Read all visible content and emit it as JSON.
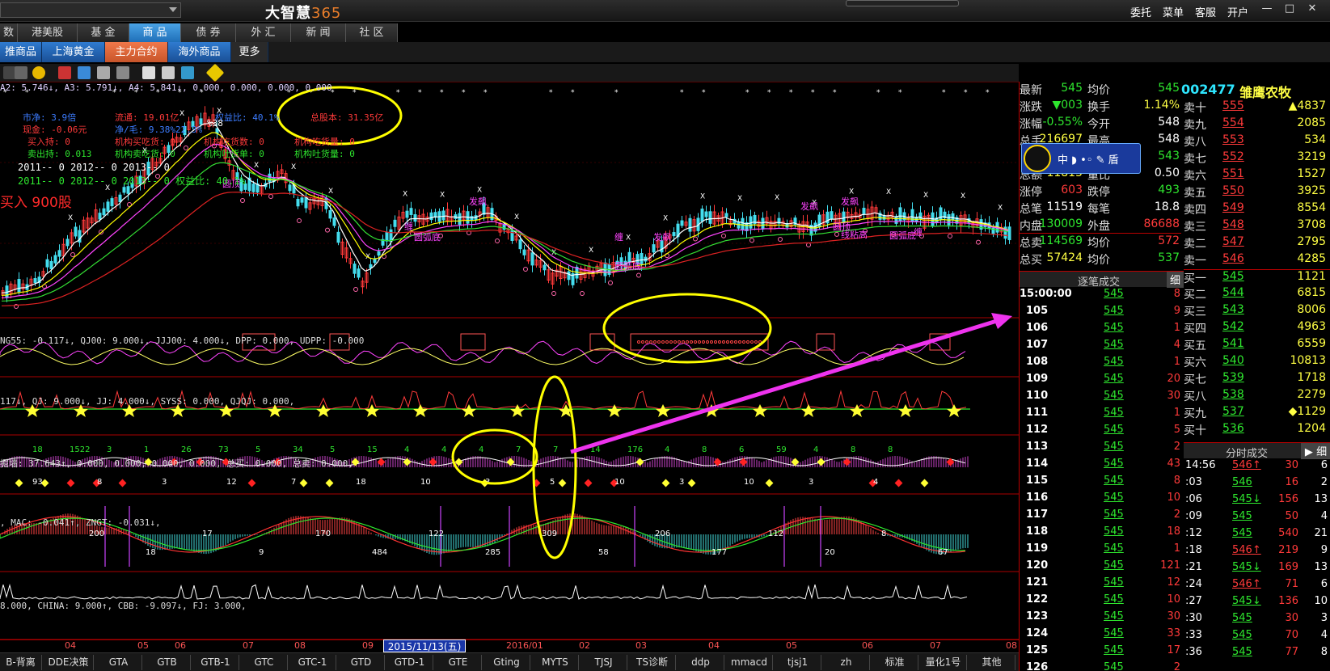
{
  "titlebar": {
    "brand": "大智慧",
    "brand_num": "365",
    "menus": [
      "委托",
      "菜单",
      "客服",
      "开户"
    ],
    "win_buttons": [
      "—",
      "□",
      "✕"
    ]
  },
  "tabs1": [
    "数",
    "港美股",
    "基 金",
    "商 品",
    "债 券",
    "外 汇",
    "新 闻",
    "社 区"
  ],
  "tabs1_active": 3,
  "tabs2": [
    "推商品",
    "上海黄金",
    "主力合约",
    "海外商品",
    "更多"
  ],
  "tabs2_active": 2,
  "chart": {
    "main_indicator": "A2: 5.746↓, A3: 5.791↓, A4: 5.841↓, 0.000, 0.000, 0.000, 0.000",
    "info": [
      {
        "t": "市净: 3.9倍",
        "c": "#3c7cff"
      },
      {
        "t": "流通: 19.01亿",
        "c": "#ff3a3a"
      },
      {
        "t": "权益比: 40.1%",
        "c": "#3c7cff"
      },
      {
        "t": "总股本: 31.35亿",
        "c": "#ff3a3a"
      },
      {
        "t": "现金: -0.06元",
        "c": "#ff3a3a"
      },
      {
        "t": "净/毛: 9.38%22.3%",
        "c": "#3c7cff"
      },
      {
        "t": "买入持: 0",
        "c": "#ff3a3a"
      },
      {
        "t": "机构买吃货: 0",
        "c": "#ff3a3a"
      },
      {
        "t": "机构吃货数: 0",
        "c": "#ff3a3a"
      },
      {
        "t": "机构吃货量: 0",
        "c": "#ff3a3a"
      },
      {
        "t": "卖出持: 0.013",
        "c": "#2ee62e"
      },
      {
        "t": "机构卖吃货: 0",
        "c": "#2ee62e"
      },
      {
        "t": "机构吐货单: 0",
        "c": "#2ee62e"
      },
      {
        "t": "机构吐货量: 0",
        "c": "#2ee62e"
      }
    ],
    "year_row1": "2011-- 0    2012-- 0    2013-- 0",
    "year_row2": "2011-- 0    2012-- 0    2013-- 0   权益比: 40.1%",
    "buy_label": "买入 900股",
    "pct_label": "%38",
    "pane_indicators": [
      {
        "t": "NG55: -0.117↓, QJ00: 9.000↓, JJJ00: 4.000↓, DPP: 0.000, UDPP: -0.000"
      },
      {
        "t": "117↓, QJ: 9.000↓, JJ: 4.000↓, SYSS: 0.000, QJQJ: 0.000,"
      },
      {
        "t": "掘墙: 37.643↑, 0.000, 0.000, 0.000, 0.000, 总买: 0.000, 总卖: 0.000,"
      },
      {
        "t": ", MAC: -0.041↑, ZNGT: -0.031↓,"
      },
      {
        "t": "8.000, CHINA: 9.000↑, CBB: -9.097↓, FJ: 3.000,"
      }
    ],
    "date_marker": "2015/11/13(五)",
    "xaxis": [
      "04",
      "05",
      "06",
      "07",
      "08",
      "09",
      "2016/01",
      "02",
      "03",
      "04",
      "05",
      "06",
      "07",
      "08"
    ],
    "annotations": [
      "发飙",
      "发飙",
      "发飙",
      "发飙",
      "圆顶",
      "圆弧底",
      "圆弧底",
      "圆弧底",
      "缠",
      "缠",
      "缠",
      "圆顶",
      "线粘高"
    ],
    "pane4_numbers": [
      "18",
      "1522",
      "3",
      "1",
      "26",
      "73",
      "5",
      "34",
      "5",
      "15",
      "4",
      "4",
      "4",
      "7",
      "7",
      "14",
      "176",
      "4",
      "8",
      "6",
      "59",
      "4",
      "8",
      "8",
      "93",
      "8",
      "3",
      "12",
      "7",
      "18",
      "10",
      "3",
      "5",
      "10",
      "3",
      "10",
      "3",
      "4"
    ],
    "pane5_numbers": [
      "200",
      "18",
      "17",
      "9",
      "170",
      "484",
      "122",
      "285",
      "309",
      "58",
      "206",
      "177",
      "112",
      "20",
      "8",
      "67"
    ]
  },
  "quote": {
    "stock_code": "002477",
    "stock_name": "雏鹰农牧",
    "left": [
      {
        "l": "最新",
        "v": "545",
        "vc": "grn",
        "l2": "均价",
        "v2": "545",
        "v2c": "grn"
      },
      {
        "l": "涨跌",
        "v": "▼003",
        "vc": "grn",
        "l2": "换手",
        "v2": "1.14%",
        "v2c": "yel"
      },
      {
        "l": "涨幅",
        "v": "-0.55%",
        "vc": "grn",
        "l2": "今开",
        "v2": "548",
        "v2c": "wht"
      },
      {
        "l": "总手",
        "v": "216697",
        "vc": "yel",
        "l2": "最高",
        "v2": "548",
        "v2c": "wht"
      },
      {
        "l": "",
        "v": "",
        "vc": "wht",
        "l2": "",
        "v2": "543",
        "v2c": "grn"
      },
      {
        "l": "总额",
        "v": "11815",
        "vc": "yel",
        "l2": "量比",
        "v2": "0.50",
        "v2c": "wht"
      },
      {
        "l": "涨停",
        "v": "603",
        "vc": "red",
        "l2": "跌停",
        "v2": "493",
        "v2c": "grn"
      },
      {
        "l": "总笔",
        "v": "11519",
        "vc": "wht",
        "l2": "每笔",
        "v2": "18.8",
        "v2c": "wht"
      },
      {
        "l": "内盘",
        "v": "130009",
        "vc": "grn",
        "l2": "外盘",
        "v2": "86688",
        "v2c": "red"
      },
      {
        "l": "总卖",
        "v": "114569",
        "vc": "grn",
        "l2": "均价",
        "v2": "572",
        "v2c": "red"
      },
      {
        "l": "总买",
        "v": "57424",
        "vc": "yel",
        "l2": "均价",
        "v2": "537",
        "v2c": "grn"
      }
    ],
    "qq_bar": "中 ◗ •◦ ✎ 盾",
    "sell": [
      {
        "l": "卖十",
        "p": "555",
        "v": "▲4837"
      },
      {
        "l": "卖九",
        "p": "554",
        "v": "2085"
      },
      {
        "l": "卖八",
        "p": "553",
        "v": "534"
      },
      {
        "l": "卖七",
        "p": "552",
        "v": "3219"
      },
      {
        "l": "卖六",
        "p": "551",
        "v": "1527"
      },
      {
        "l": "卖五",
        "p": "550",
        "v": "3925"
      },
      {
        "l": "卖四",
        "p": "549",
        "v": "8554"
      },
      {
        "l": "卖三",
        "p": "548",
        "v": "3708"
      },
      {
        "l": "卖二",
        "p": "547",
        "v": "2795"
      },
      {
        "l": "卖一",
        "p": "546",
        "v": "4285"
      }
    ],
    "buy": [
      {
        "l": "买一",
        "p": "545",
        "v": "1121"
      },
      {
        "l": "买二",
        "p": "544",
        "v": "6815"
      },
      {
        "l": "买三",
        "p": "543",
        "v": "8006"
      },
      {
        "l": "买四",
        "p": "542",
        "v": "4963"
      },
      {
        "l": "买五",
        "p": "541",
        "v": "6559"
      },
      {
        "l": "买六",
        "p": "540",
        "v": "10813"
      },
      {
        "l": "买七",
        "p": "539",
        "v": "1718"
      },
      {
        "l": "买八",
        "p": "538",
        "v": "2279"
      },
      {
        "l": "买九",
        "p": "537",
        "v": "◆1129"
      },
      {
        "l": "买十",
        "p": "536",
        "v": "1204"
      }
    ],
    "tick_header": "逐笔成交",
    "tick_tab": "细",
    "ticks": [
      {
        "t": "15:00:00",
        "p": "545",
        "v": "8"
      },
      {
        "t": "105",
        "p": "545",
        "v": "9"
      },
      {
        "t": "106",
        "p": "545",
        "v": "1"
      },
      {
        "t": "107",
        "p": "545",
        "v": "4"
      },
      {
        "t": "108",
        "p": "545",
        "v": "1"
      },
      {
        "t": "109",
        "p": "545",
        "v": "20"
      },
      {
        "t": "110",
        "p": "545",
        "v": "30"
      },
      {
        "t": "111",
        "p": "545",
        "v": "1"
      },
      {
        "t": "112",
        "p": "545",
        "v": "5"
      },
      {
        "t": "113",
        "p": "545",
        "v": "2"
      },
      {
        "t": "114",
        "p": "545",
        "v": "43"
      },
      {
        "t": "115",
        "p": "545",
        "v": "8"
      },
      {
        "t": "116",
        "p": "545",
        "v": "10"
      },
      {
        "t": "117",
        "p": "545",
        "v": "2"
      },
      {
        "t": "118",
        "p": "545",
        "v": "18"
      },
      {
        "t": "119",
        "p": "545",
        "v": "1"
      },
      {
        "t": "120",
        "p": "545",
        "v": "121"
      },
      {
        "t": "121",
        "p": "545",
        "v": "12"
      },
      {
        "t": "122",
        "p": "545",
        "v": "10"
      },
      {
        "t": "123",
        "p": "545",
        "v": "30"
      },
      {
        "t": "124",
        "p": "545",
        "v": "33"
      },
      {
        "t": "125",
        "p": "545",
        "v": "17"
      },
      {
        "t": "126",
        "p": "545",
        "v": "2"
      }
    ],
    "min_header": "分时成交",
    "min_tab": "细",
    "mins": [
      {
        "t": "14:56",
        "p": "546↑",
        "pc": "red",
        "v": "30",
        "n": "6"
      },
      {
        "t": ":03",
        "p": "546",
        "pc": "grn",
        "v": "16",
        "n": "2"
      },
      {
        "t": ":06",
        "p": "545↓",
        "pc": "grn",
        "v": "156",
        "n": "13"
      },
      {
        "t": ":09",
        "p": "545",
        "pc": "grn",
        "v": "50",
        "n": "4"
      },
      {
        "t": ":12",
        "p": "545",
        "pc": "grn",
        "v": "540",
        "n": "21"
      },
      {
        "t": ":18",
        "p": "546↑",
        "pc": "red",
        "v": "219",
        "n": "9"
      },
      {
        "t": ":21",
        "p": "545↓",
        "pc": "grn",
        "v": "169",
        "n": "13"
      },
      {
        "t": ":24",
        "p": "546↑",
        "pc": "red",
        "v": "71",
        "n": "6"
      },
      {
        "t": ":27",
        "p": "545↓",
        "pc": "grn",
        "v": "136",
        "n": "10"
      },
      {
        "t": ":30",
        "p": "545",
        "pc": "grn",
        "v": "30",
        "n": "3"
      },
      {
        "t": ":33",
        "p": "545",
        "pc": "grn",
        "v": "70",
        "n": "4"
      },
      {
        "t": ":36",
        "p": "545",
        "pc": "grn",
        "v": "77",
        "n": "8"
      }
    ]
  },
  "bottom_tabs": [
    "B-背离",
    "DDE决策",
    "GTA",
    "GTB",
    "GTB-1",
    "GTC",
    "GTC-1",
    "GTD",
    "GTD-1",
    "GTE",
    "Gting",
    "MYTS",
    "TJSJ",
    "TS诊断",
    "ddp",
    "mmacd",
    "tjsj1",
    "zh",
    "标准",
    "量化1号",
    "其他"
  ],
  "colors": {
    "up": "#ff3a3a",
    "down": "#2ee62e",
    "ma_white": "#ffffff",
    "ma_yellow": "#ffff00",
    "ma_purple": "#ff44ff",
    "ma_green": "#33dd33",
    "ma_red": "#dd2222",
    "highlight": "#ffff00",
    "arrow": "#ee33ee",
    "pane_border": "#aa0000"
  }
}
